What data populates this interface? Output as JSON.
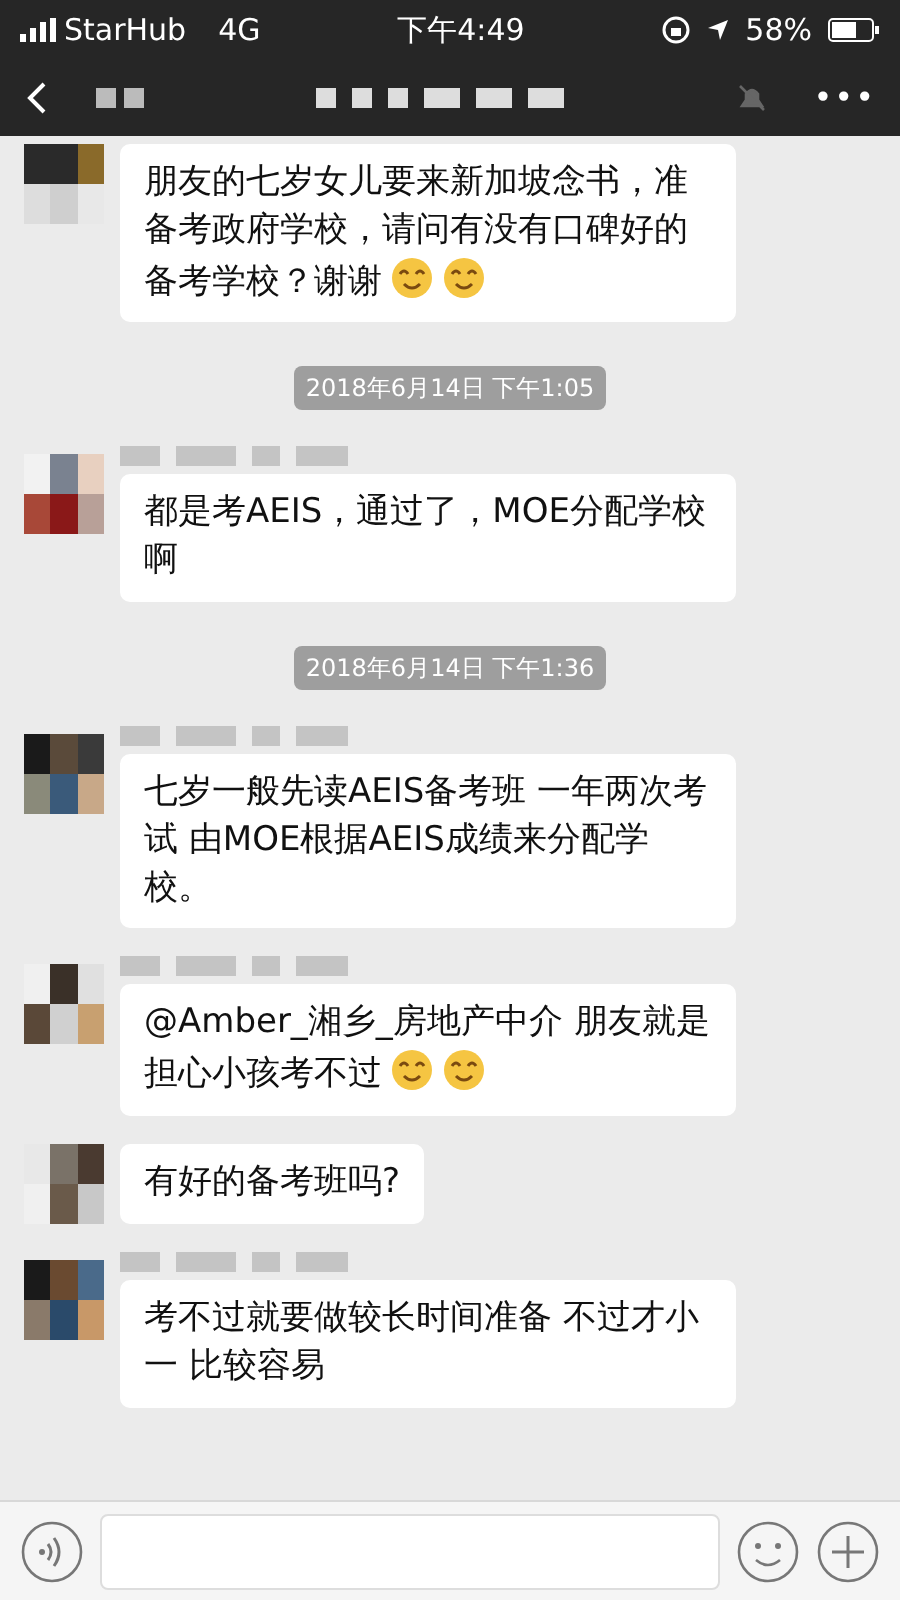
{
  "status_bar": {
    "carrier": "StarHub",
    "network": "4G",
    "time": "下午4:49",
    "battery": "58%"
  },
  "nav": {
    "more": "•••"
  },
  "messages": [
    {
      "kind": "message",
      "show_name": false,
      "parts": [
        {
          "kind": "text",
          "text": "朋友的七岁女儿要来新加坡念书，准备考政府学校，请问有没有口碑好的备考学校？谢谢"
        },
        {
          "kind": "emoji"
        },
        {
          "kind": "emoji"
        }
      ]
    },
    {
      "kind": "time",
      "text": "2018年6月14日 下午1:05"
    },
    {
      "kind": "message",
      "show_name": true,
      "parts": [
        {
          "kind": "text",
          "text": "都是考AEIS，通过了，MOE分配学校啊"
        }
      ]
    },
    {
      "kind": "time",
      "text": "2018年6月14日 下午1:36"
    },
    {
      "kind": "message",
      "show_name": true,
      "parts": [
        {
          "kind": "text",
          "text": "七岁一般先读AEIS备考班 一年两次考试 由MOE根据AEIS成绩来分配学校。"
        }
      ]
    },
    {
      "kind": "message",
      "show_name": true,
      "parts": [
        {
          "kind": "text",
          "text": "@Amber_湘乡_房地产中介 朋友就是担心小孩考不过"
        },
        {
          "kind": "emoji"
        },
        {
          "kind": "emoji"
        }
      ]
    },
    {
      "kind": "message",
      "show_name": false,
      "parts": [
        {
          "kind": "text",
          "text": "有好的备考班吗?"
        }
      ]
    },
    {
      "kind": "message",
      "show_name": true,
      "parts": [
        {
          "kind": "text",
          "text": "考不过就要做较长时间准备 不过才小一 比较容易"
        }
      ]
    }
  ]
}
